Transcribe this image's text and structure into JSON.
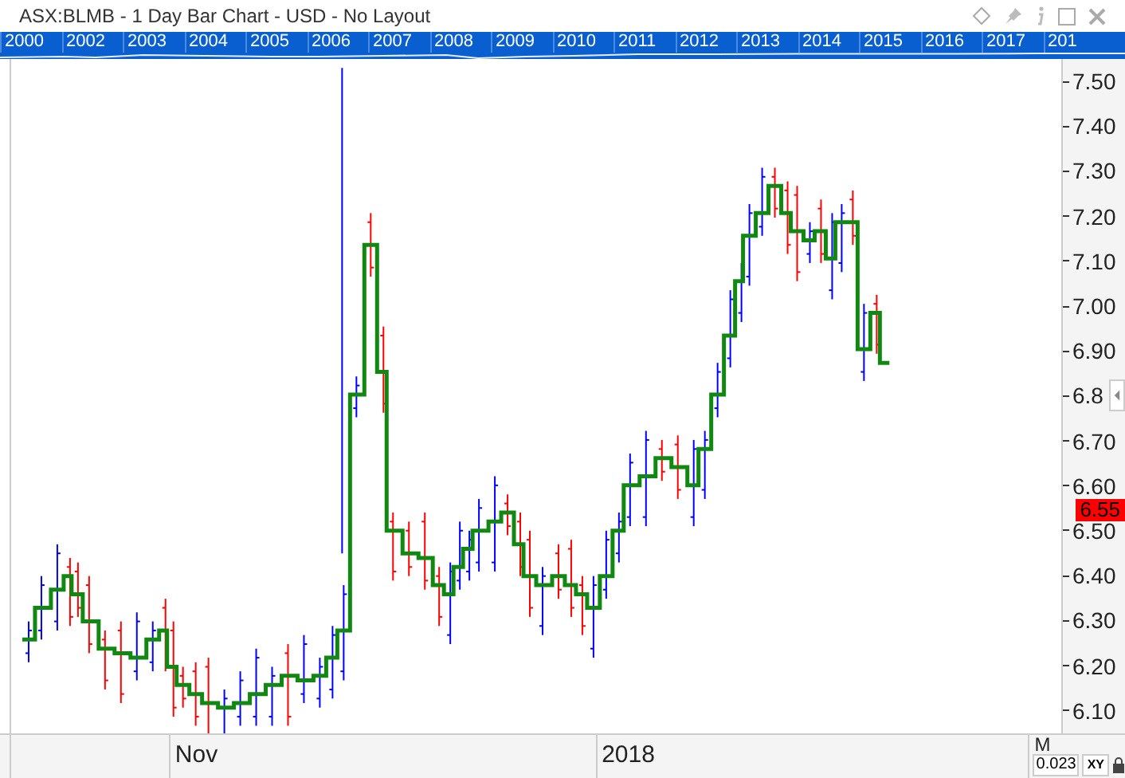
{
  "window": {
    "title": "ASX:BLMB - 1 Day Bar Chart - USD - No Layout"
  },
  "navigator": {
    "years": [
      "2000",
      "2002",
      "2003",
      "2004",
      "2005",
      "2006",
      "2007",
      "2008",
      "2009",
      "2010",
      "2011",
      "2012",
      "2013",
      "2014",
      "2015",
      "2016",
      "2017",
      "201"
    ]
  },
  "y_axis": {
    "ticks": [
      "7.50",
      "7.40",
      "7.30",
      "7.20",
      "7.10",
      "7.00",
      "6.90",
      "6.8",
      "6.70",
      "6.60",
      "6.50",
      "6.40",
      "6.30",
      "6.20",
      "6.10"
    ]
  },
  "last_price": "6.55",
  "x_axis": {
    "labels": [
      "Nov",
      "2018",
      "M"
    ]
  },
  "corner": {
    "scale": "0.023",
    "mode": "XY"
  }
}
